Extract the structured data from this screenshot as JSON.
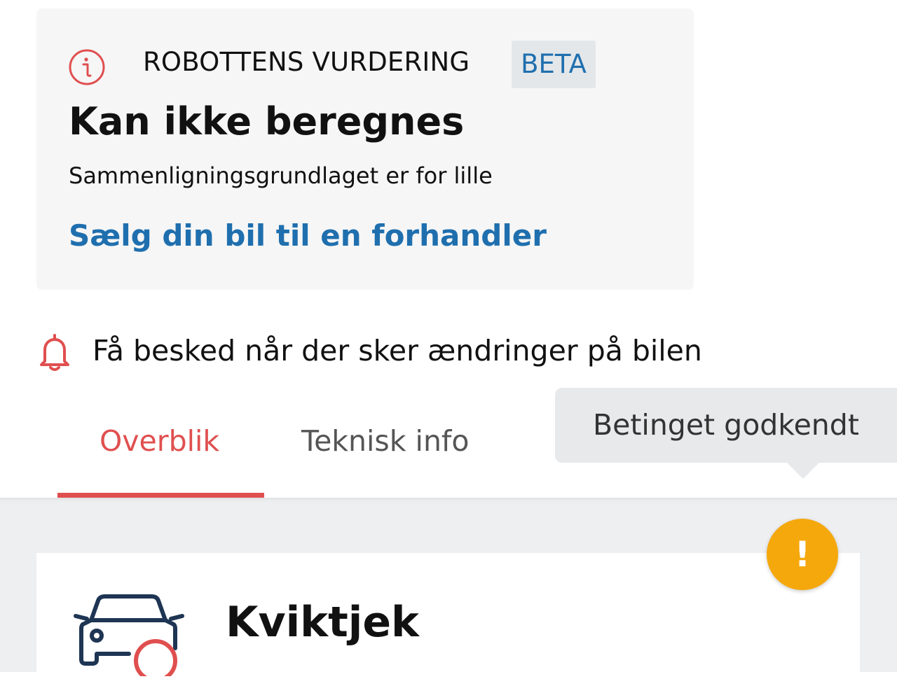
{
  "valuation": {
    "eyebrow": "ROBOTTENS VURDERING",
    "badge": "BETA",
    "title": "Kan ikke beregnes",
    "subtitle": "Sammenligningsgrundlaget er for lille",
    "link": "Sælg din bil til en forhandler",
    "icon": "info-icon"
  },
  "notification": {
    "text": "Få besked når der sker ændringer på bilen",
    "icon": "bell-icon"
  },
  "tabs": [
    {
      "label": "Overblik",
      "active": true
    },
    {
      "label": "Teknisk info",
      "active": false
    }
  ],
  "tooltip": {
    "text": "Betinget godkendt"
  },
  "quickcheck": {
    "title": "Kviktjek",
    "icon": "car-icon",
    "warning_symbol": "!"
  },
  "colors": {
    "accent_red": "#e04f4f",
    "link_blue": "#1f6fae",
    "warning_orange": "#f5a80c",
    "icon_navy": "#1e3553"
  }
}
